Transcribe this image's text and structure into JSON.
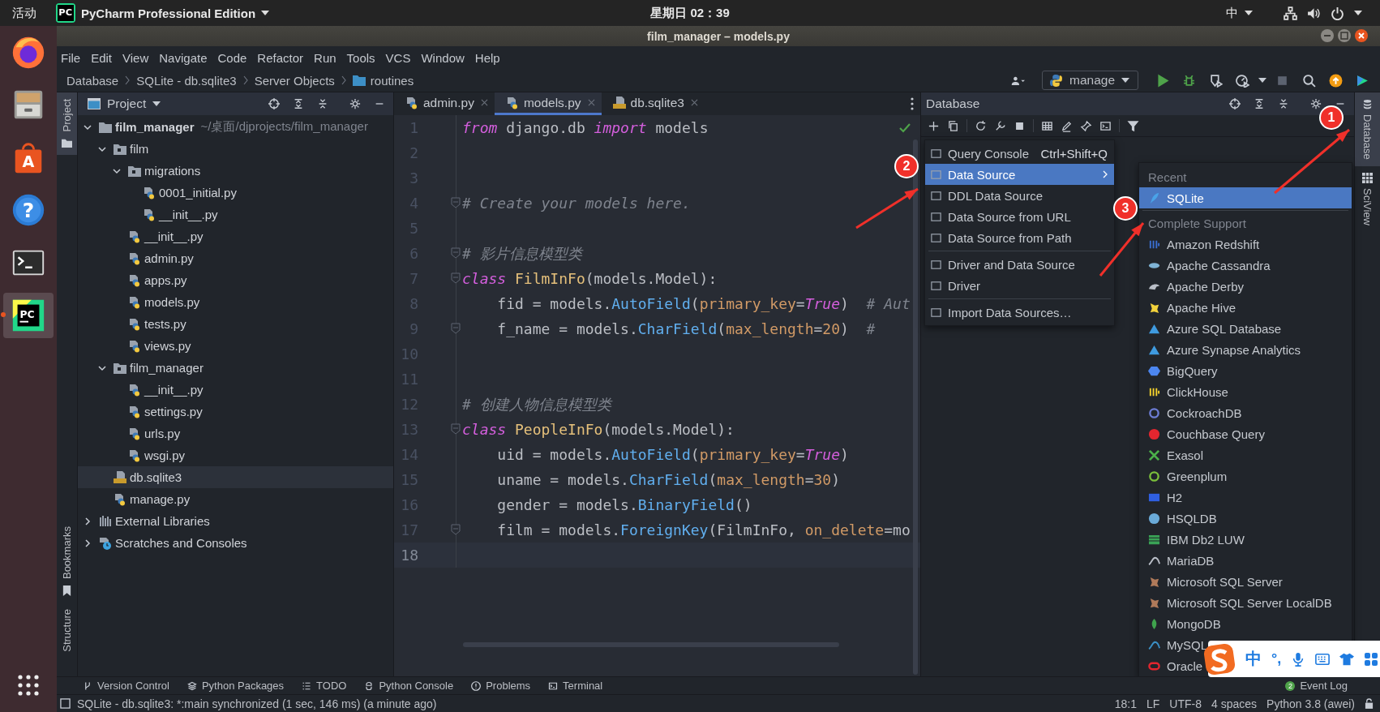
{
  "top_bar": {
    "activities": "活动",
    "app_icon": "PC",
    "app_menu": "PyCharm Professional Edition",
    "clock": "星期日 02：39",
    "input_method": "中"
  },
  "dock": [
    {
      "kind": "browser",
      "running": false
    },
    {
      "kind": "files",
      "running": false
    },
    {
      "kind": "store",
      "glyph": "A",
      "running": false
    },
    {
      "kind": "help",
      "glyph": "?",
      "running": false
    },
    {
      "kind": "terminal",
      "running": false
    },
    {
      "kind": "ide",
      "glyph": "PC",
      "running": true
    }
  ],
  "window": {
    "title": "film_manager – models.py"
  },
  "menu": [
    "File",
    "Edit",
    "View",
    "Navigate",
    "Code",
    "Refactor",
    "Run",
    "Tools",
    "VCS",
    "Window",
    "Help"
  ],
  "breadcrumbs": [
    {
      "label": "Database",
      "kind": "plain"
    },
    {
      "label": "SQLite - db.sqlite3",
      "kind": "plain"
    },
    {
      "label": "Server Objects",
      "kind": "plain"
    },
    {
      "label": "routines",
      "kind": "folder"
    }
  ],
  "run_config": "manage",
  "left_stripe": [
    {
      "label": "Project",
      "selected": true
    },
    {
      "label": "Bookmarks",
      "selected": false
    },
    {
      "label": "Structure",
      "selected": false
    }
  ],
  "right_stripe": [
    {
      "label": "Database",
      "selected": true
    },
    {
      "label": "SciView",
      "selected": false
    }
  ],
  "project": {
    "title": "Project",
    "tree": [
      {
        "name": "film_manager",
        "path": "~/桌面/djprojects/film_manager",
        "kind": "root",
        "expanded": true,
        "selected": false,
        "children": [
          {
            "name": "film",
            "kind": "module",
            "expanded": true,
            "selected": false,
            "children": [
              {
                "name": "migrations",
                "kind": "module",
                "expanded": true,
                "selected": false,
                "children": [
                  {
                    "name": "0001_initial.py",
                    "kind": "python",
                    "selected": false
                  },
                  {
                    "name": "__init__.py",
                    "kind": "python",
                    "selected": false
                  }
                ]
              },
              {
                "name": "__init__.py",
                "kind": "python",
                "selected": false
              },
              {
                "name": "admin.py",
                "kind": "python",
                "selected": false
              },
              {
                "name": "apps.py",
                "kind": "python",
                "selected": false
              },
              {
                "name": "models.py",
                "kind": "python",
                "selected": false
              },
              {
                "name": "tests.py",
                "kind": "python",
                "selected": false
              },
              {
                "name": "views.py",
                "kind": "python",
                "selected": false
              }
            ]
          },
          {
            "name": "film_manager",
            "kind": "module",
            "expanded": true,
            "selected": false,
            "children": [
              {
                "name": "__init__.py",
                "kind": "python",
                "selected": false
              },
              {
                "name": "settings.py",
                "kind": "python",
                "selected": false
              },
              {
                "name": "urls.py",
                "kind": "python",
                "selected": false
              },
              {
                "name": "wsgi.py",
                "kind": "python",
                "selected": false
              }
            ]
          },
          {
            "name": "db.sqlite3",
            "kind": "sqlite",
            "selected": true
          },
          {
            "name": "manage.py",
            "kind": "python",
            "selected": false
          }
        ]
      },
      {
        "name": "External Libraries",
        "kind": "libraries",
        "expanded": false,
        "selected": false
      },
      {
        "name": "Scratches and Consoles",
        "kind": "scratches",
        "expanded": false,
        "selected": false
      }
    ]
  },
  "editor": {
    "tabs": [
      {
        "label": "admin.py",
        "kind": "python",
        "selected": false
      },
      {
        "label": "models.py",
        "kind": "python",
        "selected": true
      },
      {
        "label": "db.sqlite3",
        "kind": "sqlite",
        "selected": false
      }
    ],
    "lines": [
      {
        "number": "1",
        "fold": false,
        "current": false,
        "tokens": [
          {
            "text": "from",
            "kind": "kw"
          },
          {
            "text": " django.db ",
            "kind": "plain"
          },
          {
            "text": "import",
            "kind": "kw"
          },
          {
            "text": " models",
            "kind": "plain"
          }
        ]
      },
      {
        "number": "2",
        "fold": false,
        "current": false
      },
      {
        "number": "3",
        "fold": false,
        "current": false
      },
      {
        "number": "4",
        "fold": true,
        "current": false,
        "tokens": [
          {
            "text": "# Create your models here.",
            "kind": "comment"
          }
        ]
      },
      {
        "number": "5",
        "fold": false,
        "current": false
      },
      {
        "number": "6",
        "fold": true,
        "current": false,
        "tokens": [
          {
            "text": "# 影片信息模型类",
            "kind": "comment"
          }
        ]
      },
      {
        "number": "7",
        "fold": true,
        "current": false,
        "tokens": [
          {
            "text": "class",
            "kind": "kw"
          },
          {
            "text": " FilmInFo",
            "kind": "cls"
          },
          {
            "text": "(models.Model):",
            "kind": "plain"
          }
        ]
      },
      {
        "number": "8",
        "fold": false,
        "current": false,
        "tokens": [
          {
            "text": "    fid = models.",
            "kind": "plain"
          },
          {
            "text": "AutoField",
            "kind": "call"
          },
          {
            "text": "(",
            "kind": "plain"
          },
          {
            "text": "primary_key",
            "kind": "param"
          },
          {
            "text": "=",
            "kind": "plain"
          },
          {
            "text": "True",
            "kind": "const"
          },
          {
            "text": ")  ",
            "kind": "plain"
          },
          {
            "text": "# Aut",
            "kind": "comment"
          }
        ]
      },
      {
        "number": "9",
        "fold": true,
        "current": false,
        "tokens": [
          {
            "text": "    f_name = models.",
            "kind": "plain"
          },
          {
            "text": "CharField",
            "kind": "call"
          },
          {
            "text": "(",
            "kind": "plain"
          },
          {
            "text": "max_length",
            "kind": "param"
          },
          {
            "text": "=",
            "kind": "plain"
          },
          {
            "text": "20",
            "kind": "num"
          },
          {
            "text": ")  ",
            "kind": "plain"
          },
          {
            "text": "#",
            "kind": "comment"
          }
        ]
      },
      {
        "number": "10",
        "fold": false,
        "current": false
      },
      {
        "number": "11",
        "fold": false,
        "current": false
      },
      {
        "number": "12",
        "fold": false,
        "current": false,
        "tokens": [
          {
            "text": "# 创建人物信息模型类",
            "kind": "comment"
          }
        ]
      },
      {
        "number": "13",
        "fold": true,
        "current": false,
        "tokens": [
          {
            "text": "class",
            "kind": "kw"
          },
          {
            "text": " PeopleInFo",
            "kind": "cls"
          },
          {
            "text": "(models.Model):",
            "kind": "plain"
          }
        ]
      },
      {
        "number": "14",
        "fold": false,
        "current": false,
        "tokens": [
          {
            "text": "    uid = models.",
            "kind": "plain"
          },
          {
            "text": "AutoField",
            "kind": "call"
          },
          {
            "text": "(",
            "kind": "plain"
          },
          {
            "text": "primary_key",
            "kind": "param"
          },
          {
            "text": "=",
            "kind": "plain"
          },
          {
            "text": "True",
            "kind": "const"
          },
          {
            "text": ")",
            "kind": "plain"
          }
        ]
      },
      {
        "number": "15",
        "fold": false,
        "current": false,
        "tokens": [
          {
            "text": "    uname = models.",
            "kind": "plain"
          },
          {
            "text": "CharField",
            "kind": "call"
          },
          {
            "text": "(",
            "kind": "plain"
          },
          {
            "text": "max_length",
            "kind": "param"
          },
          {
            "text": "=",
            "kind": "plain"
          },
          {
            "text": "30",
            "kind": "num"
          },
          {
            "text": ")",
            "kind": "plain"
          }
        ]
      },
      {
        "number": "16",
        "fold": false,
        "current": false,
        "tokens": [
          {
            "text": "    gender = models.",
            "kind": "plain"
          },
          {
            "text": "BinaryField",
            "kind": "call"
          },
          {
            "text": "()",
            "kind": "plain"
          }
        ]
      },
      {
        "number": "17",
        "fold": true,
        "current": false,
        "tokens": [
          {
            "text": "    film = models.",
            "kind": "plain"
          },
          {
            "text": "ForeignKey",
            "kind": "call"
          },
          {
            "text": "(FilmInFo, ",
            "kind": "plain"
          },
          {
            "text": "on_delete",
            "kind": "param"
          },
          {
            "text": "=mo",
            "kind": "plain"
          }
        ]
      },
      {
        "number": "18",
        "fold": false,
        "current": true
      }
    ]
  },
  "database": {
    "title": "Database",
    "menu": [
      [
        {
          "label": "Query Console",
          "shortcut": "Ctrl+Shift+Q",
          "submenu": false,
          "selected": false
        },
        {
          "label": "Data Source",
          "submenu": true,
          "selected": true
        },
        {
          "label": "DDL Data Source",
          "submenu": false,
          "selected": false
        },
        {
          "label": "Data Source from URL",
          "submenu": false,
          "selected": false
        },
        {
          "label": "Data Source from Path",
          "submenu": false,
          "selected": false
        }
      ],
      [
        {
          "label": "Driver and Data Source",
          "submenu": false,
          "selected": false
        },
        {
          "label": "Driver",
          "submenu": false,
          "selected": false
        }
      ],
      [
        {
          "label": "Import Data Sources…",
          "submenu": false,
          "selected": false
        }
      ]
    ],
    "submenu": [
      {
        "header": "Recent",
        "items": [
          {
            "label": "SQLite",
            "selected": true
          }
        ]
      },
      {
        "header": "Complete Support",
        "items": [
          {
            "label": "Amazon Redshift",
            "selected": false
          },
          {
            "label": "Apache Cassandra",
            "selected": false
          },
          {
            "label": "Apache Derby",
            "selected": false
          },
          {
            "label": "Apache Hive",
            "selected": false
          },
          {
            "label": "Azure SQL Database",
            "selected": false
          },
          {
            "label": "Azure Synapse Analytics",
            "selected": false
          },
          {
            "label": "BigQuery",
            "selected": false
          },
          {
            "label": "ClickHouse",
            "selected": false
          },
          {
            "label": "CockroachDB",
            "selected": false
          },
          {
            "label": "Couchbase Query",
            "selected": false
          },
          {
            "label": "Exasol",
            "selected": false
          },
          {
            "label": "Greenplum",
            "selected": false
          },
          {
            "label": "H2",
            "selected": false
          },
          {
            "label": "HSQLDB",
            "selected": false
          },
          {
            "label": "IBM Db2 LUW",
            "selected": false
          },
          {
            "label": "MariaDB",
            "selected": false
          },
          {
            "label": "Microsoft SQL Server",
            "selected": false
          },
          {
            "label": "Microsoft SQL Server LocalDB",
            "selected": false
          },
          {
            "label": "MongoDB",
            "selected": false
          },
          {
            "label": "MySQL",
            "selected": false
          },
          {
            "label": "Oracle",
            "selected": false
          }
        ]
      }
    ]
  },
  "annotations": [
    {
      "number": "1"
    },
    {
      "number": "2"
    },
    {
      "number": "3"
    }
  ],
  "ime_bar": {
    "mode": "中",
    "punctuation": "°,"
  },
  "tool_windows": [
    "Version Control",
    "Python Packages",
    "TODO",
    "Python Console",
    "Problems",
    "Terminal"
  ],
  "event_log": {
    "label": "Event Log",
    "count": "2"
  },
  "status_bar": {
    "message": "SQLite - db.sqlite3: *:main synchronized (1 sec, 146 ms) (a minute ago)",
    "position": "18:1",
    "line_separator": "LF",
    "encoding": "UTF-8",
    "indent": "4 spaces",
    "interpreter": "Python 3.8 (awei)"
  }
}
